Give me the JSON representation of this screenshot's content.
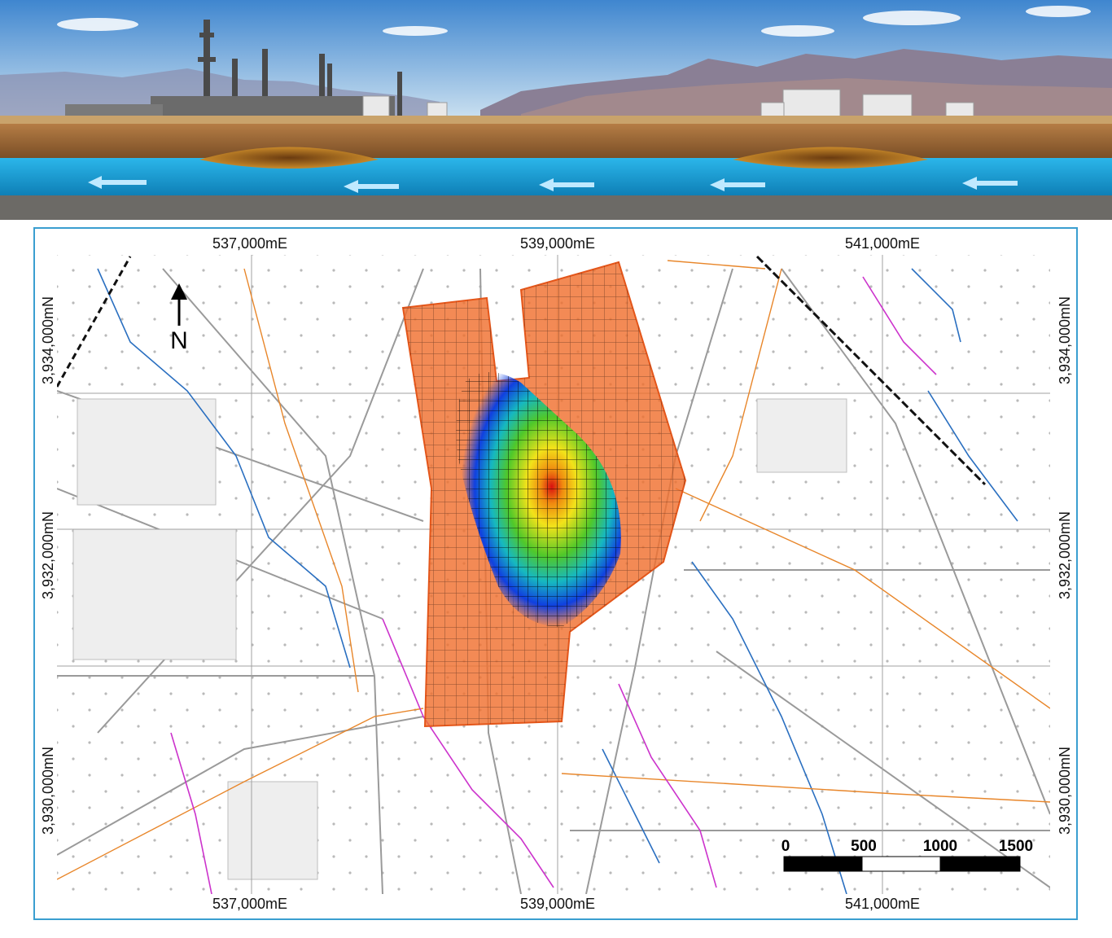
{
  "map": {
    "easting_labels": [
      "537,000mE",
      "539,000mE",
      "541,000mE"
    ],
    "northing_labels": [
      "3,934,000mN",
      "3,932,000mN",
      "3,930,000mN"
    ],
    "north_arrow": "N",
    "scale_bar": {
      "ticks": [
        "0",
        "500",
        "1000",
        "1500"
      ]
    },
    "colors": {
      "frame": "#3a9ed0",
      "model_domain": "#f07030",
      "aquifer": "#1aa3d9",
      "contamination_high": "#e01010",
      "contamination_low": "#1040e0"
    }
  },
  "banner": {
    "icons": [
      "refinery-icon",
      "storage-tank-icon",
      "mountain-icon",
      "groundwater-flow-arrow-icon",
      "plume-lens-icon"
    ]
  }
}
